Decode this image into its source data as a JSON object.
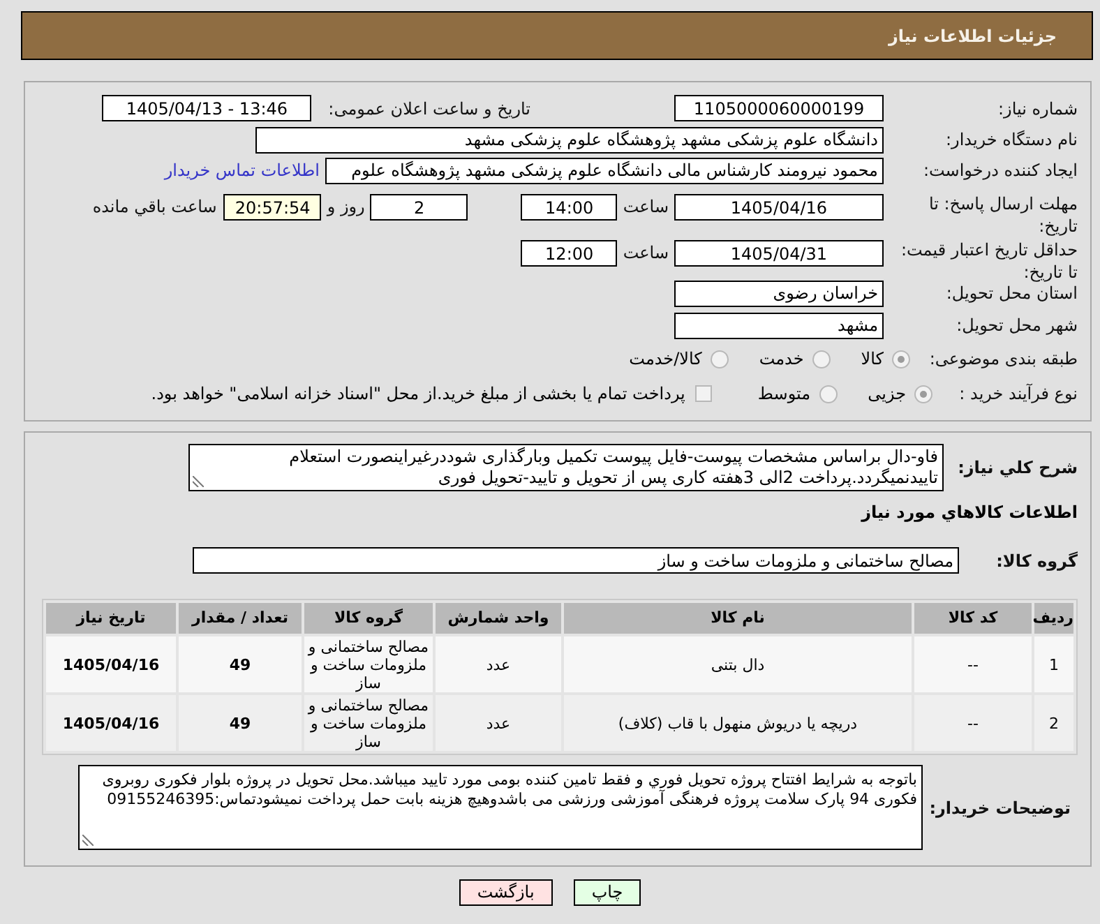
{
  "header": {
    "title": "جزئیات اطلاعات نیاز"
  },
  "details": {
    "need_number": {
      "label": "شماره نیاز:",
      "value": "1105000060000199"
    },
    "announce": {
      "label": "تاریخ و ساعت اعلان عمومی:",
      "value": "1405/04/13 - 13:46"
    },
    "buyer_org": {
      "label": "نام دستگاه خریدار:",
      "value": "دانشگاه علوم پزشکی مشهد   پژوهشگاه علوم پزشکی مشهد"
    },
    "requester": {
      "label": "ایجاد کننده درخواست:",
      "value": "محمود نیرومند کارشناس مالی دانشگاه علوم پزشکی مشهد   پژوهشگاه علوم",
      "link": "اطلاعات تماس خریدار"
    },
    "response_deadline": {
      "label": "مهلت ارسال پاسخ: تا تاریخ:",
      "date": "1405/04/16",
      "time_label": "ساعت",
      "time": "14:00",
      "days": "2",
      "days_label": "روز و",
      "remaining": "20:57:54",
      "remaining_label": "ساعت باقي مانده"
    },
    "price_validity": {
      "label": "حداقل تاریخ اعتبار قیمت: تا تاریخ:",
      "date": "1405/04/31",
      "time_label": "ساعت",
      "time": "12:00"
    },
    "province": {
      "label": "استان محل تحویل:",
      "value": "خراسان رضوی"
    },
    "city": {
      "label": "شهر محل تحویل:",
      "value": "مشهد"
    },
    "category": {
      "label": "طبقه بندی موضوعی:",
      "disabled": true,
      "options": [
        {
          "label": "کالا",
          "selected": true
        },
        {
          "label": "خدمت",
          "selected": false
        },
        {
          "label": "کالا/خدمت",
          "selected": false
        }
      ]
    },
    "process": {
      "label": "نوع فرآیند خرید :",
      "disabled": true,
      "options": [
        {
          "label": "جزیی",
          "selected": true
        },
        {
          "label": "متوسط",
          "selected": false
        }
      ],
      "treasury": {
        "label": "پرداخت تمام یا بخشی از مبلغ خرید.از محل \"اسناد خزانه اسلامی\" خواهد بود.",
        "checked": false,
        "disabled": true
      }
    }
  },
  "need": {
    "description": {
      "label": "شرح کلي نیاز:",
      "value": "فاو-دال براساس مشخصات پیوست-فایل پیوست تکمیل وبارگذاری شوددرغیراینصورت استعلام تاییدنمیگردد.پرداخت 2الی 3هفته کاری پس از تحویل و تایید-تحویل فوری"
    },
    "items_title": "اطلاعات کالاهاي مورد نیاز",
    "group": {
      "label": "گروه کالا:",
      "value": "مصالح ساختمانی و ملزومات ساخت و ساز"
    },
    "table": {
      "columns": [
        "ردیف",
        "کد کالا",
        "نام کالا",
        "واحد شمارش",
        "گروه کالا",
        "تعداد / مقدار",
        "تاریخ نیاز"
      ],
      "rows": [
        [
          "1",
          "--",
          "دال بتنی",
          "عدد",
          "مصالح ساختمانی و ملزومات ساخت و ساز",
          "49",
          "1405/04/16"
        ],
        [
          "2",
          "--",
          "دریچه یا دریوش منهول با قاب (کلاف)",
          "عدد",
          "مصالح ساختمانی و ملزومات ساخت و ساز",
          "49",
          "1405/04/16"
        ]
      ]
    },
    "buyer_notes": {
      "label": "توضیحات خریدار:",
      "value": "باتوجه به شرایط افتتاح پروژه تحویل فوري و فقط تامین کننده بومی مورد تایید میباشد.محل تحویل در پروژه بلوار فکوری روبروی فکوری 94 پارک سلامت پروژه فرهنگی آموزشی ورزشی می باشدوهیچ هزینه بابت حمل  پرداخت نمیشودتماس:09155246395"
    }
  },
  "buttons": [
    {
      "label": "چاپ",
      "kind": "print"
    },
    {
      "label": "بازگشت",
      "kind": "back"
    }
  ]
}
